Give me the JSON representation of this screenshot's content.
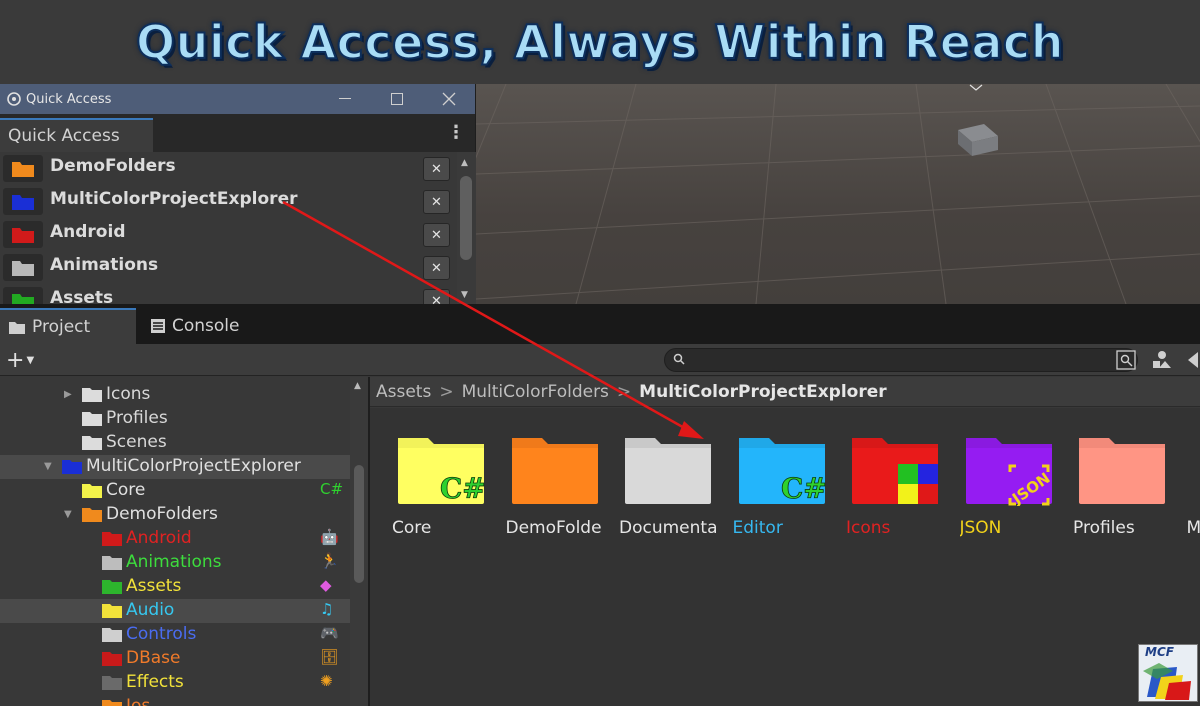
{
  "banner": {
    "title": "Quick Access, Always Within Reach"
  },
  "quick_access_window": {
    "window_title": "Quick Access",
    "tab_label": "Quick Access",
    "items": [
      {
        "label": "DemoFolders",
        "color": "#f08a1d"
      },
      {
        "label": "MultiColorProjectExplorer",
        "color": "#1a2fd6"
      },
      {
        "label": "Android",
        "color": "#d11a1a"
      },
      {
        "label": "Animations",
        "color": "#b8b8b8"
      },
      {
        "label": "Assets",
        "color": "#22aa22"
      }
    ],
    "remove_label": "✕"
  },
  "project_window": {
    "tabs": [
      {
        "label": "Project",
        "icon": "folder-icon"
      },
      {
        "label": "Console",
        "icon": "console-icon"
      }
    ],
    "add_label": "+",
    "search": {
      "value": "",
      "placeholder": ""
    },
    "tree": [
      {
        "name": "Icons",
        "color": "#d8d8d8",
        "folder_color": "#dcdcdc",
        "depth": 1,
        "arrow": "▶"
      },
      {
        "name": "Profiles",
        "color": "#d8d8d8",
        "folder_color": "#dcdcdc",
        "depth": 1,
        "arrow": ""
      },
      {
        "name": "Scenes",
        "color": "#d8d8d8",
        "folder_color": "#dcdcdc",
        "depth": 1,
        "arrow": ""
      },
      {
        "name": "MultiColorProjectExplorer",
        "color": "#e0e0e0",
        "folder_color": "#1a2fd6",
        "depth": 0,
        "arrow": "▼",
        "selected": true
      },
      {
        "name": "Core",
        "color": "#e0e0e0",
        "folder_color": "#f2f24a",
        "depth": 1,
        "arrow": "",
        "badge": "C#",
        "badge_color": "#2fd12f"
      },
      {
        "name": "DemoFolders",
        "color": "#e0e0e0",
        "folder_color": "#f08a1d",
        "depth": 1,
        "arrow": "▼"
      },
      {
        "name": "Android",
        "color": "#e02222",
        "folder_color": "#d11a1a",
        "depth": 2,
        "arrow": "",
        "badge": "🤖",
        "badge_color": "#cfcfcf"
      },
      {
        "name": "Animations",
        "color": "#3ddc3d",
        "folder_color": "#bdbdbd",
        "depth": 2,
        "arrow": "",
        "badge": "🏃",
        "badge_color": "#3a8bff"
      },
      {
        "name": "Assets",
        "color": "#f2e23a",
        "folder_color": "#2db52d",
        "depth": 2,
        "arrow": "",
        "badge": "◆",
        "badge_color": "#e05be0"
      },
      {
        "name": "Audio",
        "color": "#36c8f0",
        "folder_color": "#f2e23a",
        "depth": 2,
        "arrow": "",
        "badge": "♫",
        "badge_color": "#36c8f0",
        "selected": true
      },
      {
        "name": "Controls",
        "color": "#4a6cf0",
        "folder_color": "#cfcfcf",
        "depth": 2,
        "arrow": "",
        "badge": "🎮",
        "badge_color": "#cfcfcf"
      },
      {
        "name": "DBase",
        "color": "#f07a2a",
        "folder_color": "#c81a1a",
        "depth": 2,
        "arrow": "",
        "badge": "🗄",
        "badge_color": "#f0a020"
      },
      {
        "name": "Effects",
        "color": "#f2e23a",
        "folder_color": "#6a6a6a",
        "depth": 2,
        "arrow": "",
        "badge": "✺",
        "badge_color": "#f0a020"
      },
      {
        "name": "Ios",
        "color": "#f07a2a",
        "folder_color": "#f08a1d",
        "depth": 2,
        "arrow": "",
        "badge": "",
        "badge_color": "#3a8bff"
      }
    ],
    "breadcrumb": [
      "Assets",
      "MultiColorFolders",
      "MultiColorProjectExplorer"
    ],
    "breadcrumb_sep": ">",
    "grid": [
      {
        "name": "Core",
        "color": "#e6e6e6",
        "folder": "#f2f25a",
        "overlay": "C#"
      },
      {
        "name": "DemoFolde",
        "color": "#e6e6e6",
        "folder": "#f07a1a",
        "overlay": ""
      },
      {
        "name": "Documenta",
        "color": "#e6e6e6",
        "folder": "#c9c9c9",
        "overlay": ""
      },
      {
        "name": "Editor",
        "color": "#36b8f0",
        "folder": "#20a8e8",
        "overlay": "C#"
      },
      {
        "name": "Icons",
        "color": "#e02222",
        "folder": "#d81818",
        "overlay": "quad"
      },
      {
        "name": "JSON",
        "color": "#f2d21a",
        "folder": "#8a1ae0",
        "overlay": "JSON"
      },
      {
        "name": "Profiles",
        "color": "#e6e6e6",
        "folder": "#f28a7a",
        "overlay": ""
      },
      {
        "name": "M",
        "color": "#e6e6e6",
        "folder": "",
        "overlay": ""
      }
    ]
  },
  "logo": {
    "text": "MCF"
  }
}
